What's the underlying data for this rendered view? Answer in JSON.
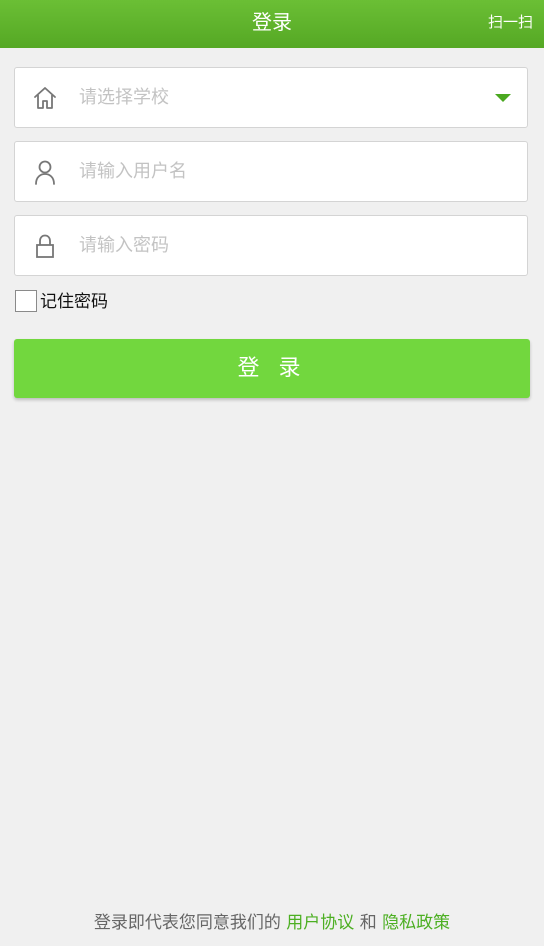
{
  "header": {
    "title": "登录",
    "scan_label": "扫一扫"
  },
  "form": {
    "school": {
      "placeholder": "请选择学校",
      "icon": "home-icon"
    },
    "username": {
      "placeholder": "请输入用户名",
      "icon": "user-icon"
    },
    "password": {
      "placeholder": "请输入密码",
      "icon": "lock-icon"
    },
    "remember_label": "记住密码",
    "login_label": "登 录"
  },
  "footer": {
    "prefix": "登录即代表您同意我们的",
    "user_agreement": "用户协议",
    "and": "和",
    "privacy_policy": "隐私政策"
  },
  "colors": {
    "header_green": "#5cb22c",
    "button_green": "#72d73e",
    "link_green": "#4caf22",
    "background": "#f0f0f0"
  }
}
